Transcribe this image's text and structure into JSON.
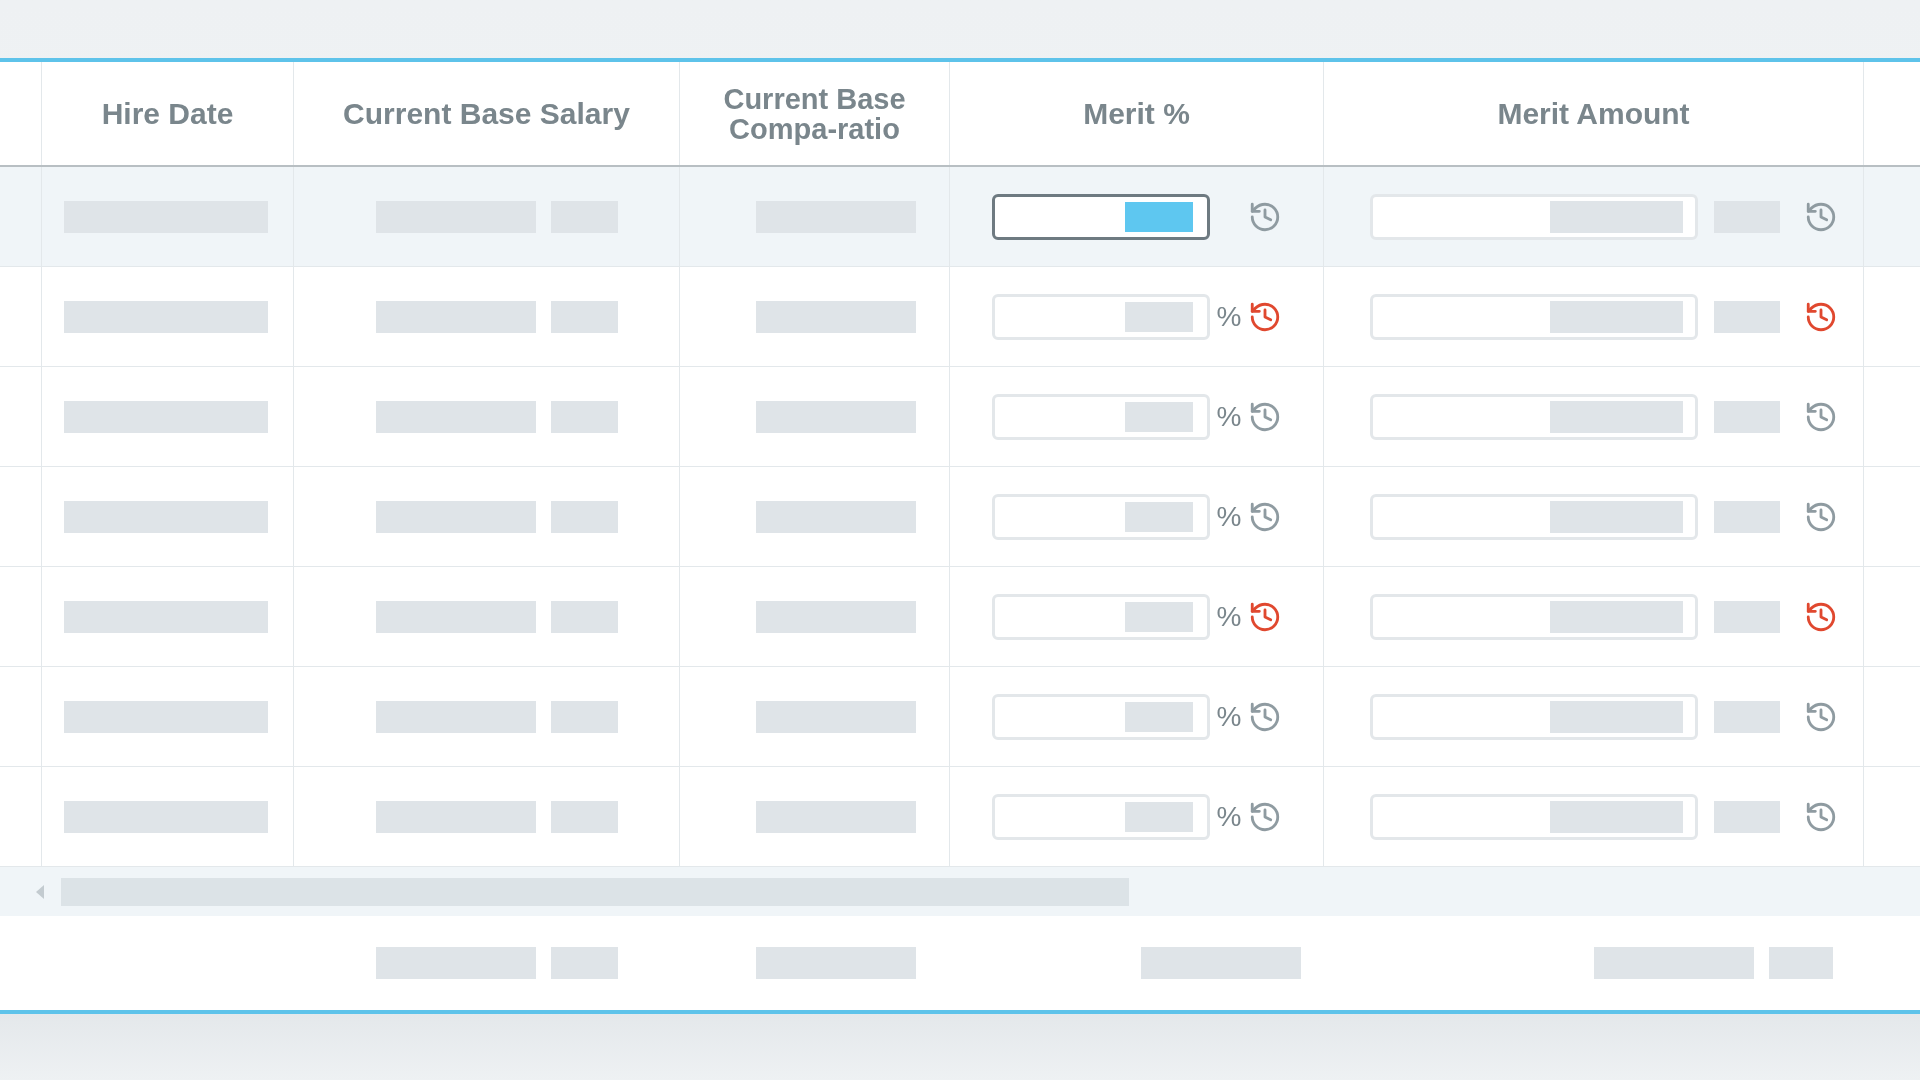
{
  "table": {
    "columns": [
      "Hire Date",
      "Current Base Salary",
      "Current Base Compa-ratio",
      "Merit %",
      "Merit Amount"
    ],
    "rows": [
      {
        "selected": true,
        "focused": true,
        "unit": null,
        "modified": false
      },
      {
        "selected": false,
        "focused": false,
        "unit": "%",
        "modified": true
      },
      {
        "selected": false,
        "focused": false,
        "unit": "%",
        "modified": false
      },
      {
        "selected": false,
        "focused": false,
        "unit": "%",
        "modified": false
      },
      {
        "selected": false,
        "focused": false,
        "unit": "%",
        "modified": true
      },
      {
        "selected": false,
        "focused": false,
        "unit": "%",
        "modified": false
      },
      {
        "selected": false,
        "focused": false,
        "unit": "%",
        "modified": false
      }
    ]
  }
}
